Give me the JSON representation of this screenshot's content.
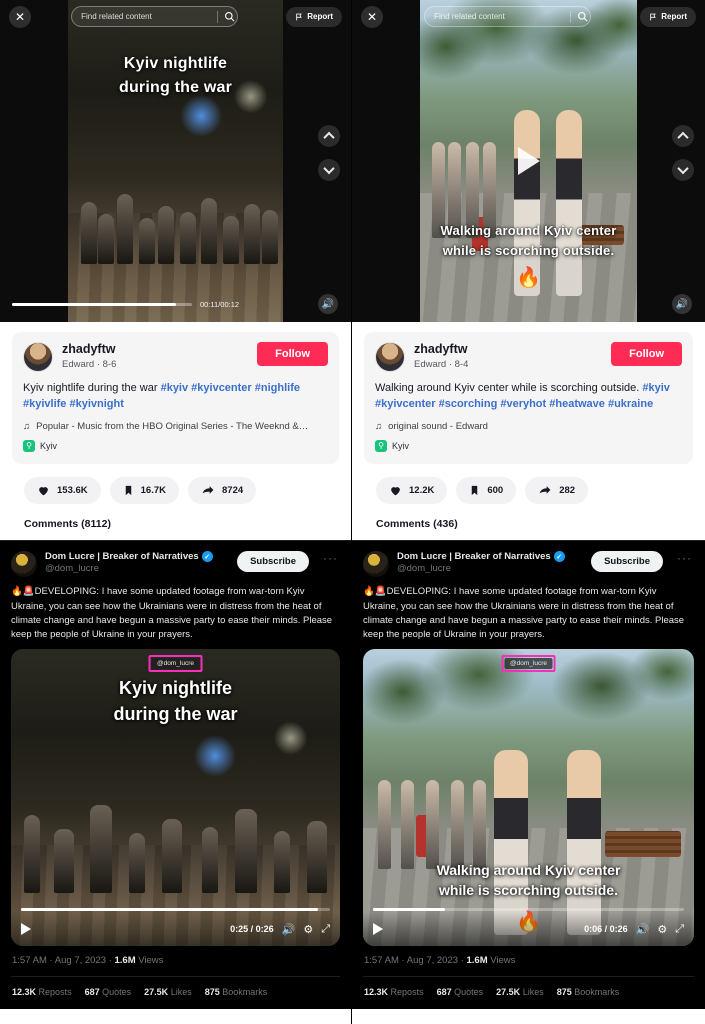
{
  "panels": [
    {
      "id": "left",
      "tiktok": {
        "topbar": {
          "close_icon": "close-icon",
          "search_placeholder": "Find related content",
          "search_icon": "search-icon",
          "report_label": "Report",
          "report_icon": "flag-icon"
        },
        "video": {
          "caption_line1": "Kyiv nightlife",
          "caption_line2": "during the war",
          "caption_position": "top",
          "time": "00:11/00:12",
          "progress_percent": 91,
          "paused": false,
          "volume_icon": "volume-on-icon",
          "nav_up_icon": "chevron-up-icon",
          "nav_down_icon": "chevron-down-icon"
        },
        "author": {
          "username": "zhadyftw",
          "display": "Edward · 8-6",
          "follow_label": "Follow"
        },
        "description": "Kyiv nightlife during the war ",
        "hashtags": [
          "#kyiv",
          "#kyivcenter",
          "#nighlife",
          "#kyivlife",
          "#kyivnight"
        ],
        "music_icon": "music-note-icon",
        "music": "Popular - Music from the HBO Original Series - The Weeknd &…",
        "place_icon": "location-pin-icon",
        "place": "Kyiv",
        "stats": [
          {
            "icon": "heart-icon",
            "value": "153.6K"
          },
          {
            "icon": "bookmark-icon",
            "value": "16.7K"
          },
          {
            "icon": "share-arrow-icon",
            "value": "8724"
          }
        ],
        "comments_header": "Comments (8112)"
      },
      "x_post": {
        "display_name": "Dom Lucre | Breaker of Narratives",
        "verified_icon": "verified-badge-icon",
        "handle": "@dom_lucre",
        "subscribe_label": "Subscribe",
        "more_icon": "more-options-icon",
        "text": "🔥🚨DEVELOPING: I have some updated footage from war-torn Kyiv Ukraine, you can see how the Ukrainians were in distress from the heat of climate change and have begun a massive party to ease their minds. Please keep the people of Ukraine in your prayers.",
        "video": {
          "watermark": "@dom_lucre",
          "highlight_color": "#f52fbc",
          "caption_line1": "Kyiv nightlife",
          "caption_line2": "during the war",
          "caption_position": "top",
          "time": "0:25 / 0:26",
          "progress_percent": 96,
          "play_icon": "play-icon",
          "volume_icon": "volume-on-icon",
          "settings_icon": "settings-gear-icon",
          "fullscreen_icon": "fullscreen-icon"
        },
        "timestamp": "1:57 AM",
        "date": "Aug 7, 2023",
        "views_count": "1.6M",
        "views_label": "Views",
        "engagement": [
          {
            "count": "12.3K",
            "label": "Reposts"
          },
          {
            "count": "687",
            "label": "Quotes"
          },
          {
            "count": "27.5K",
            "label": "Likes"
          },
          {
            "count": "875",
            "label": "Bookmarks"
          }
        ]
      }
    },
    {
      "id": "right",
      "tiktok": {
        "topbar": {
          "close_icon": "close-icon",
          "search_placeholder": "Find related content",
          "search_icon": "search-icon",
          "report_label": "Report",
          "report_icon": "flag-icon"
        },
        "video": {
          "caption_line1": "Walking around Kyiv center",
          "caption_line2": "while is scorching outside.",
          "caption_position": "bottom",
          "fire_emoji": "🔥",
          "time": "",
          "progress_percent": 0,
          "paused": true,
          "play_icon": "play-icon",
          "volume_icon": "volume-on-icon",
          "nav_up_icon": "chevron-up-icon",
          "nav_down_icon": "chevron-down-icon"
        },
        "author": {
          "username": "zhadyftw",
          "display": "Edward · 8-4",
          "follow_label": "Follow"
        },
        "description": "Walking around Kyiv center while is scorching outside. ",
        "hashtags": [
          "#kyiv",
          "#kyivcenter",
          "#scorching",
          "#veryhot",
          "#heatwave",
          "#ukraine"
        ],
        "music_icon": "music-note-icon",
        "music": "original sound - Edward",
        "place_icon": "location-pin-icon",
        "place": "Kyiv",
        "stats": [
          {
            "icon": "heart-icon",
            "value": "12.2K"
          },
          {
            "icon": "bookmark-icon",
            "value": "600"
          },
          {
            "icon": "share-arrow-icon",
            "value": "282"
          }
        ],
        "comments_header": "Comments (436)"
      },
      "x_post": {
        "display_name": "Dom Lucre | Breaker of Narratives",
        "verified_icon": "verified-badge-icon",
        "handle": "@dom_lucre",
        "subscribe_label": "Subscribe",
        "more_icon": "more-options-icon",
        "text": "🔥🚨DEVELOPING: I have some updated footage from war-torn Kyiv Ukraine, you can see how the Ukrainians were in distress from the heat of climate change and have begun a massive party to ease their minds. Please keep the people of Ukraine in your prayers.",
        "video": {
          "watermark": "@dom_lucre",
          "highlight_color": "#f52fbc",
          "caption_line1": "Walking around Kyiv center",
          "caption_line2": "while is scorching outside.",
          "caption_position": "bottom",
          "fire_emoji": "🔥",
          "time": "0:06 / 0:26",
          "progress_percent": 23,
          "play_icon": "play-icon",
          "volume_icon": "volume-on-icon",
          "settings_icon": "settings-gear-icon",
          "fullscreen_icon": "fullscreen-icon"
        },
        "timestamp": "1:57 AM",
        "date": "Aug 7, 2023",
        "views_count": "1.6M",
        "views_label": "Views",
        "engagement": [
          {
            "count": "12.3K",
            "label": "Reposts"
          },
          {
            "count": "687",
            "label": "Quotes"
          },
          {
            "count": "27.5K",
            "label": "Likes"
          },
          {
            "count": "875",
            "label": "Bookmarks"
          }
        ]
      }
    }
  ],
  "colors": {
    "tiktok_accent": "#fe2c55",
    "hashtag_blue": "#3b6ecc",
    "verified_blue": "#1d9bf0",
    "highlight_pink": "#f52fbc",
    "x_background": "#000000",
    "x_text": "#e7e9ea",
    "x_muted": "#71767b"
  }
}
